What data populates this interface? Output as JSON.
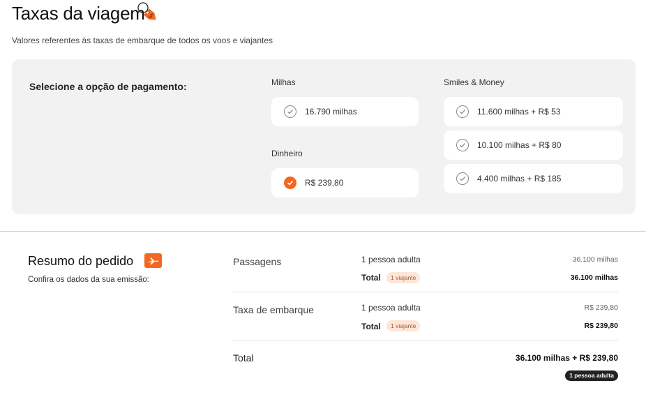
{
  "header": {
    "title": "Taxas da viagem",
    "tag_glyph": "$",
    "subtitle": "Valores referentes às taxas de embarque de todos os voos e viajantes"
  },
  "payment": {
    "label": "Selecione a opção de pagamento:",
    "groups": {
      "milhas": {
        "label": "Milhas",
        "options": [
          {
            "text": "16.790 milhas",
            "selected": false
          }
        ]
      },
      "dinheiro": {
        "label": "Dinheiro",
        "options": [
          {
            "text": "R$ 239,80",
            "selected": true
          }
        ]
      },
      "smiles_money": {
        "label": "Smiles & Money",
        "options": [
          {
            "text": "11.600 milhas + R$ 53",
            "selected": false
          },
          {
            "text": "10.100 milhas + R$ 80",
            "selected": false
          },
          {
            "text": "4.400 milhas + R$ 185",
            "selected": false
          }
        ]
      }
    }
  },
  "summary": {
    "title": "Resumo do pedido",
    "subtitle": "Confira os dados da sua emissão:",
    "rows": [
      {
        "label": "Passagens",
        "passenger": "1 pessoa adulta",
        "value": "36.100 milhas",
        "total_label": "Total",
        "badge": "1 viajante",
        "total_value": "36.100 milhas"
      },
      {
        "label": "Taxa de embarque",
        "passenger": "1 pessoa adulta",
        "value": "R$ 239,80",
        "total_label": "Total",
        "badge": "1 viajante",
        "total_value": "R$ 239,80"
      }
    ],
    "grand_total": {
      "label": "Total",
      "value": "36.100 milhas + R$ 239,80",
      "badge": "1 pessoa adulta"
    }
  },
  "colors": {
    "accent": "#f26722",
    "panel_bg": "#f2f2f2",
    "badge_bg": "#fce6d9",
    "dark_badge_bg": "#222222"
  },
  "icons": {
    "title_icon": "price-tag-icon",
    "summary_icon": "airplane-ticket-icon",
    "radio": "check-icon"
  }
}
